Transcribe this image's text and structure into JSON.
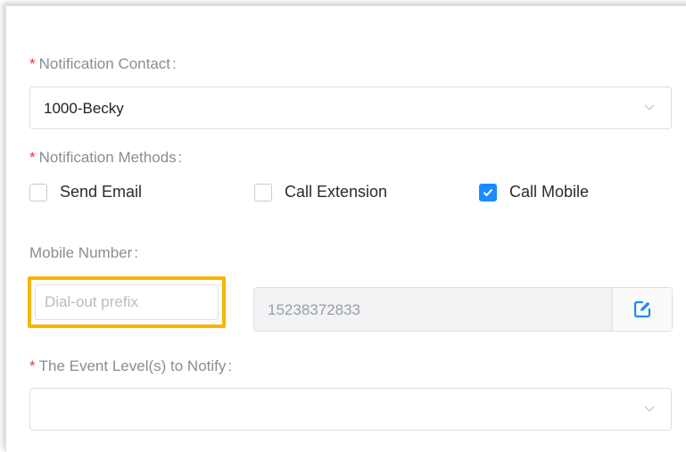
{
  "notification_contact": {
    "label": "Notification Contact",
    "colon": ":",
    "value": "1000-Becky"
  },
  "notification_methods": {
    "label": "Notification Methods",
    "colon": ":",
    "options": [
      {
        "label": "Send Email",
        "checked": false
      },
      {
        "label": "Call Extension",
        "checked": false
      },
      {
        "label": "Call Mobile",
        "checked": true
      }
    ]
  },
  "mobile_number": {
    "label": "Mobile Number",
    "colon": ":",
    "prefix_placeholder": "Dial-out prefix",
    "number": "15238372833"
  },
  "event_levels": {
    "label": "The Event Level(s) to Notify",
    "colon": ":",
    "value": ""
  },
  "required_marker": "*",
  "colors": {
    "accent": "#1a8cff",
    "required": "#e4393c",
    "highlight": "#f7b500"
  }
}
